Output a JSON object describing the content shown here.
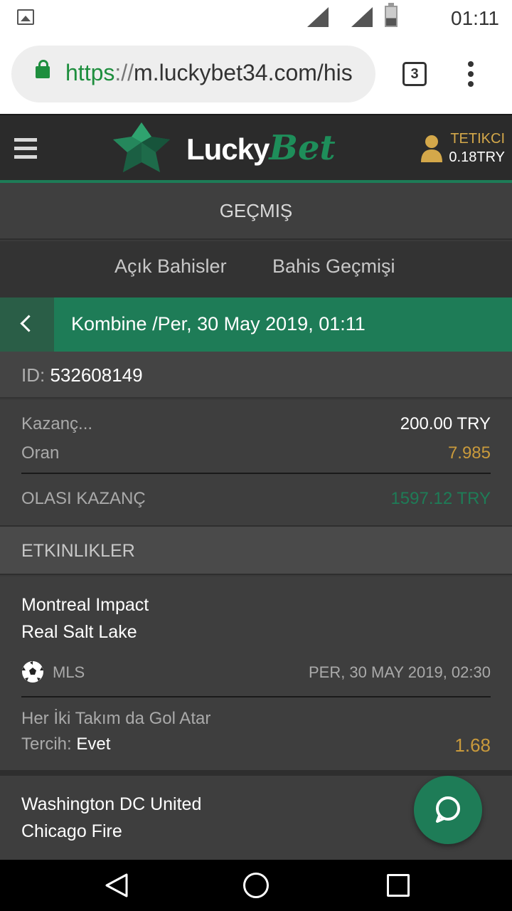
{
  "statusbar": {
    "time": "01:11"
  },
  "browser": {
    "url_scheme": "https",
    "url_sep": "://",
    "url_rest": "m.luckybet34.com/his",
    "tab_count": "3"
  },
  "header": {
    "logo_lucky": "Lucky",
    "logo_bet": "Bet",
    "username": "TETIKCI",
    "balance": "0.18TRY"
  },
  "page_title": "GEÇMIŞ",
  "tabs": [
    {
      "label": "Açık Bahisler"
    },
    {
      "label": "Bahis Geçmişi"
    }
  ],
  "bet": {
    "title": "Kombine /Per, 30 May 2019, 01:11",
    "id_label": "ID: ",
    "id_value": "532608149",
    "stake_label": "Kazanç...",
    "stake_value": "200.00 TRY",
    "odds_label": "Oran",
    "odds_value": "7.985",
    "potential_label": "OLASI KAZANÇ",
    "potential_value": "1597.12 TRY"
  },
  "events_header": "ETKINLIKLER",
  "events": [
    {
      "home": "Montreal Impact",
      "away": "Real Salt Lake",
      "league": "MLS",
      "date": "PER, 30 MAY 2019, 02:30",
      "market": "Her İki Takım da Gol Atar",
      "choice_label": "Tercih: ",
      "choice_value": "Evet",
      "odd": "1.68"
    },
    {
      "home": "Washington DC United",
      "away": "Chicago Fire"
    }
  ],
  "colors": {
    "accent_green": "#1e7c57",
    "gold": "#c99a3c",
    "header_bg": "#2b2b2b",
    "body_bg": "#3e3e3e"
  },
  "icons": {
    "menu": "hamburger-icon",
    "user": "user-icon",
    "back": "chevron-left-icon",
    "sport": "soccer-ball-icon",
    "chat": "chat-bubble-icon"
  }
}
